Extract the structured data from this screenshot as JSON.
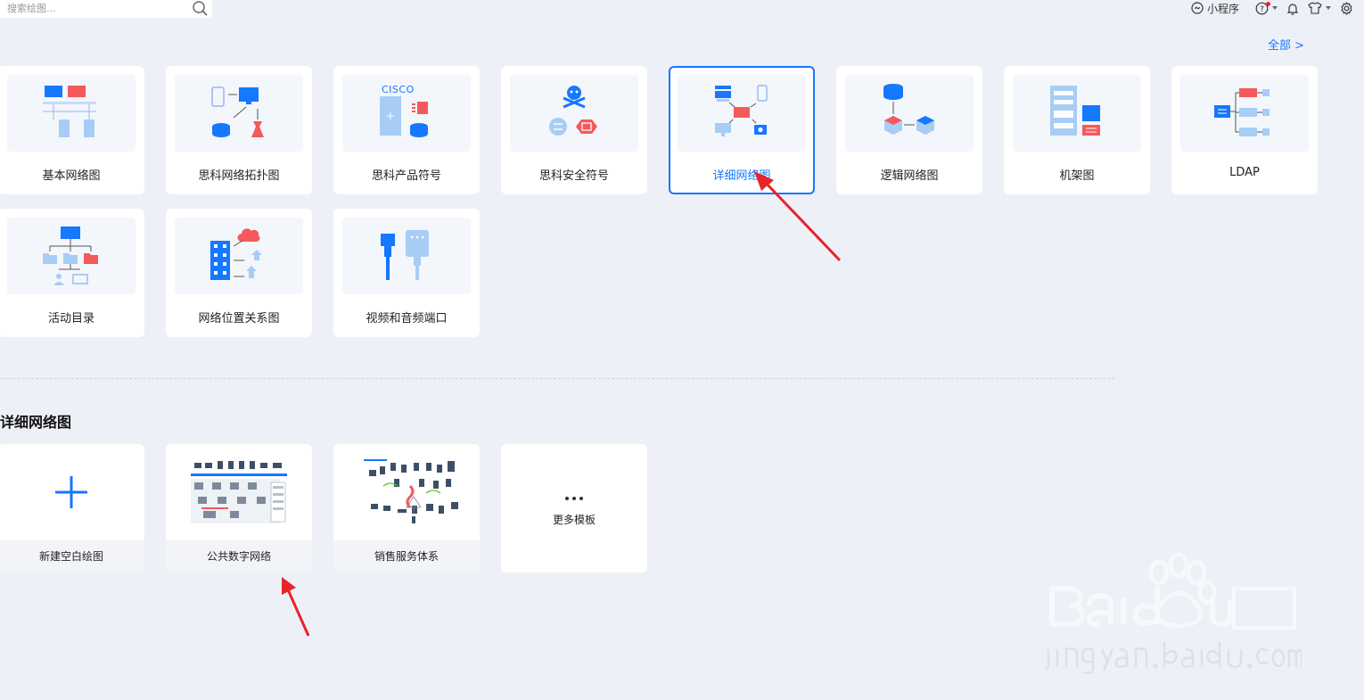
{
  "search": {
    "placeholder": "搜索绘图..."
  },
  "topbar": {
    "miniprogram": "小程序"
  },
  "categories": {
    "view_all": "全部  >",
    "items": [
      {
        "label": "基本网络图"
      },
      {
        "label": "思科网络拓扑图"
      },
      {
        "label": "思科产品符号",
        "thumb_text": "CISCO"
      },
      {
        "label": "思科安全符号"
      },
      {
        "label": "详细网络图",
        "selected": true
      },
      {
        "label": "逻辑网络图"
      },
      {
        "label": "机架图"
      },
      {
        "label": "LDAP"
      },
      {
        "label": "活动目录"
      },
      {
        "label": "网络位置关系图"
      },
      {
        "label": "视频和音频端口"
      }
    ]
  },
  "templates": {
    "title": "详细网络图",
    "items": [
      {
        "label": "新建空白绘图"
      },
      {
        "label": "公共数字网络"
      },
      {
        "label": "销售服务体系"
      },
      {
        "label": "更多模板"
      }
    ]
  },
  "colors": {
    "accent": "#1677ff",
    "red": "#f5595b",
    "light_blue": "#a8cdf5",
    "annotation": "#e8232a"
  }
}
